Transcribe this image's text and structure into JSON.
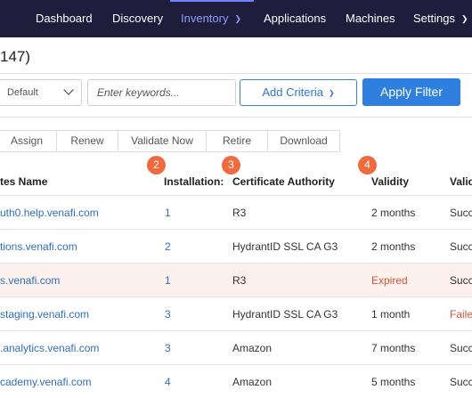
{
  "nav": [
    {
      "label": "Dashboard",
      "active": false,
      "dropdown": false
    },
    {
      "label": "Discovery",
      "active": false,
      "dropdown": false
    },
    {
      "label": "Inventory",
      "active": true,
      "dropdown": true
    },
    {
      "label": "Applications",
      "active": false,
      "dropdown": false
    },
    {
      "label": "Machines",
      "active": false,
      "dropdown": false
    },
    {
      "label": "Settings",
      "active": false,
      "dropdown": true
    }
  ],
  "page_count": "147)",
  "filter": {
    "select_value": "Default",
    "search_placeholder": "Enter keywords...",
    "add_criteria_label": "Add Criteria",
    "apply_label": "Apply Filter"
  },
  "actions": [
    "Assign",
    "Renew",
    "Validate Now",
    "Retire",
    "Download"
  ],
  "columns": [
    "tes Name",
    "Installation:",
    "Certificate Authority",
    "Validity",
    "Valid"
  ],
  "badges": [
    "2",
    "3",
    "4"
  ],
  "rows": [
    {
      "name": "uth0.help.venafi.com",
      "installations": "1",
      "ca": "R3",
      "validity": "2 months",
      "status": "Succ",
      "expired": false,
      "failed": false
    },
    {
      "name": "tions.venafi.com",
      "installations": "2",
      "ca": "HydrantID SSL CA G3",
      "validity": "2 months",
      "status": "Succ",
      "expired": false,
      "failed": false
    },
    {
      "name": "s.venafi.com",
      "installations": "1",
      "ca": "R3",
      "validity": "Expired",
      "status": "Succ",
      "expired": true,
      "failed": false
    },
    {
      "name": "staging.venafi.com",
      "installations": "3",
      "ca": "HydrantID SSL CA G3",
      "validity": "1 month",
      "status": "Faile",
      "expired": false,
      "failed": true
    },
    {
      "name": ".analytics.venafi.com",
      "installations": "3",
      "ca": "Amazon",
      "validity": "7 months",
      "status": "Succ",
      "expired": false,
      "failed": false
    },
    {
      "name": "cademy.venafi.com",
      "installations": "4",
      "ca": "Amazon",
      "validity": "5 months",
      "status": "Succ",
      "expired": false,
      "failed": false
    }
  ],
  "colors": {
    "nav_bg": "#1e1e3c",
    "nav_active": "#8d9cff",
    "accent": "#2e7fde",
    "badge": "#ef6a3e",
    "error": "#d2543a",
    "link": "#2f6fbd"
  }
}
